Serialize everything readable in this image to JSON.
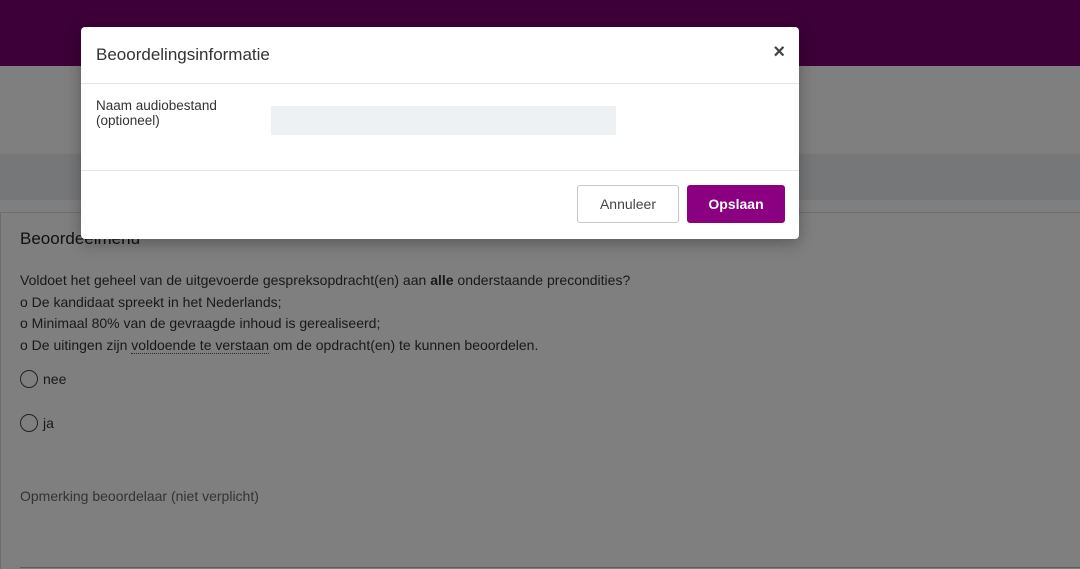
{
  "page": {
    "card_title": "Beoordeelmenu",
    "question": {
      "intro_before": "Voldoet het geheel van de uitgevoerde gespreksopdracht(en) aan ",
      "intro_bold": "alle",
      "intro_after": " onderstaande precondities?",
      "condition_1": "o De kandidaat spreekt in het Nederlands;",
      "condition_2": "o Minimaal 80% van de gevraagde inhoud is gerealiseerd;",
      "condition_3_before": "o De uitingen zijn ",
      "condition_3_link": "voldoende te verstaan",
      "condition_3_after": " om de opdracht(en) te kunnen beoordelen."
    },
    "options": [
      {
        "label": "nee"
      },
      {
        "label": "ja"
      }
    ],
    "remark_label": "Opmerking beoordelaar (niet verplicht)"
  },
  "modal": {
    "title": "Beoordelingsinformatie",
    "close_symbol": "×",
    "field_label_line1": "Naam audiobestand",
    "field_label_line2": "(optioneel)",
    "field_value": "",
    "cancel_label": "Annuleer",
    "save_label": "Opslaan"
  },
  "colors": {
    "brand": "#7b0070",
    "save_button": "#8a0080",
    "input_bg": "#eef1f4"
  }
}
